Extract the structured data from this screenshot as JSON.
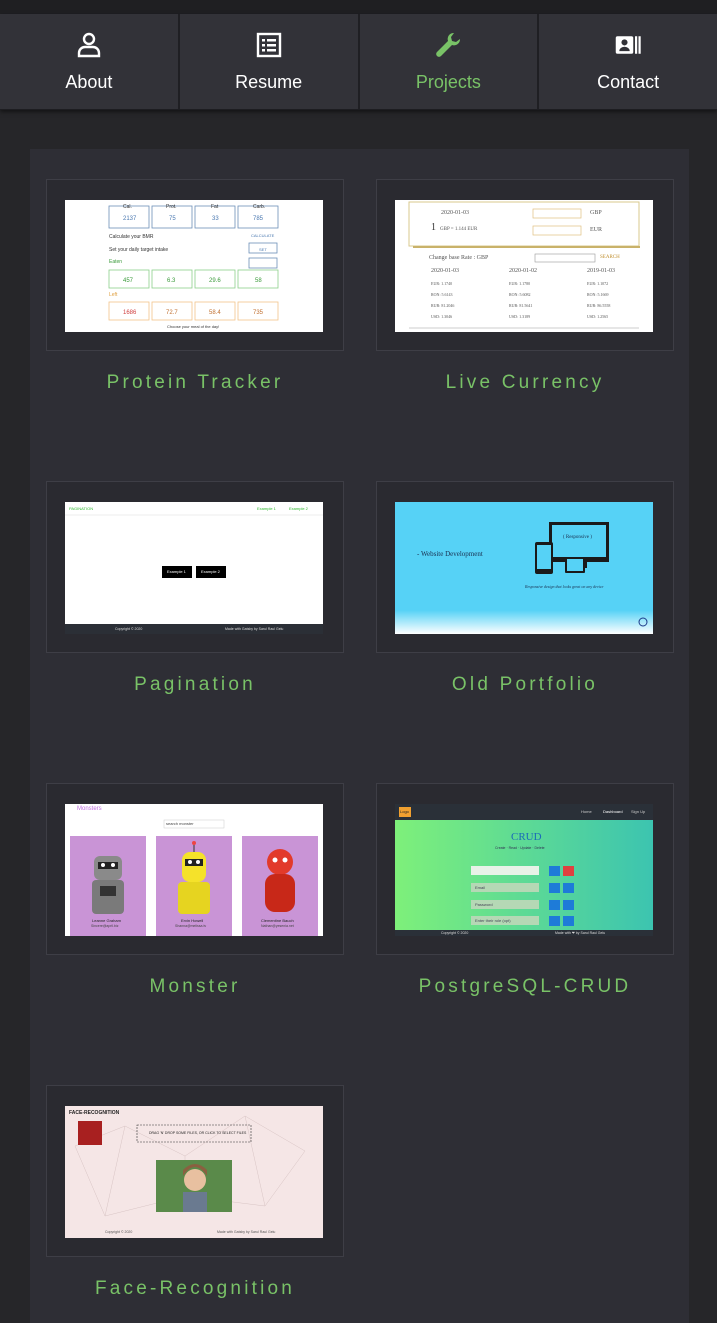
{
  "nav": {
    "items": [
      {
        "label": "About",
        "icon": "person-icon"
      },
      {
        "label": "Resume",
        "icon": "list-icon"
      },
      {
        "label": "Projects",
        "icon": "wrench-icon",
        "active": true
      },
      {
        "label": "Contact",
        "icon": "contact-card-icon"
      }
    ]
  },
  "projects": [
    {
      "title": "Protein Tracker"
    },
    {
      "title": "Live Currency"
    },
    {
      "title": "Pagination"
    },
    {
      "title": "Old Portfolio"
    },
    {
      "title": "Monster"
    },
    {
      "title": "PostgreSQL-CRUD"
    },
    {
      "title": "Face-Recognition"
    }
  ],
  "thumbs": {
    "protein": {
      "row1": [
        "Cal.",
        "Prot.",
        "Fat",
        "Carb."
      ],
      "row1_values": [
        "2137",
        "75",
        "33",
        "785"
      ],
      "calc_label": "Calculate your BMR",
      "calc_button": "CALCULATE",
      "target_label": "Set your daily target intake",
      "set_button": "SET",
      "eaten_label": "Eaten",
      "row2_values": [
        "457",
        "6.3",
        "29.6",
        "58"
      ],
      "left_label": "Left",
      "row3_values": [
        "1686",
        "72.7",
        "58.4",
        "735"
      ],
      "footer": "Choose your meal of the day!"
    },
    "currency": {
      "date": "2020-01-03",
      "amount_text": "1",
      "gbp_line": "GBP = 1.144 EUR",
      "from": "GBP",
      "to": "EUR",
      "base_label": "Change base Rate : GBP",
      "search": "SEARCH",
      "dates": [
        "2020-01-03",
        "2020-01-02",
        "2019-01-03"
      ],
      "rows": [
        [
          "EUR: 1.1740",
          "EUR: 1.1780",
          "EUR: 1.1072"
        ],
        [
          "RON: 5.6143",
          "RON: 5.6082",
          "RON: 5.1669"
        ],
        [
          "RUB: 81.2046",
          "RUB: 81.5641",
          "RUB: 86.5558"
        ],
        [
          "USD: 1.3046",
          "USD: 1.3189",
          "USD: 1.2565"
        ]
      ]
    },
    "pagination": {
      "brand": "PAGINATION",
      "links": [
        "Example 1",
        "Example 2"
      ],
      "buttons": [
        "Example 1",
        "Example 2"
      ],
      "copyright": "Copyright © 2020",
      "made": "Made with Gatsby by Sarul Raul Gelu"
    },
    "portfolio": {
      "headline": "- Website Development",
      "responsive": "( Responsive )",
      "caption": "Responsive design that looks great on any device"
    },
    "monster": {
      "brand": "Monsters",
      "search": "search monster",
      "cards": [
        {
          "name": "Leanne Graham",
          "email": "Sincere@april.biz"
        },
        {
          "name": "Ervin Howell",
          "email": "Shanna@melissa.tv"
        },
        {
          "name": "Clementine Bauch",
          "email": "Nathan@yesenia.net"
        }
      ]
    },
    "crud": {
      "logo": "Logo",
      "nav": [
        "Home",
        "Dashboard",
        "Sign Up"
      ],
      "heading": "CRUD",
      "subnav": "Create · Read · Update · Delete",
      "fields": [
        "",
        "Email",
        "Password",
        "Enter their role (opt)"
      ],
      "copyright": "Copyright © 2020",
      "made": "Made with ❤ by Sarul Raul Gelu"
    },
    "face": {
      "brand": "FACE-RECOGNITION",
      "instruction": "DRAG 'N' DROP SOME FILES, OR CLICK TO SELECT FILES",
      "copyright": "Copyright © 2020",
      "made": "Made with Gatsby by Sarul Raul Gelu"
    }
  },
  "colors": {
    "accent": "#79c267",
    "background": "#262629",
    "panel": "#2e2e35"
  }
}
